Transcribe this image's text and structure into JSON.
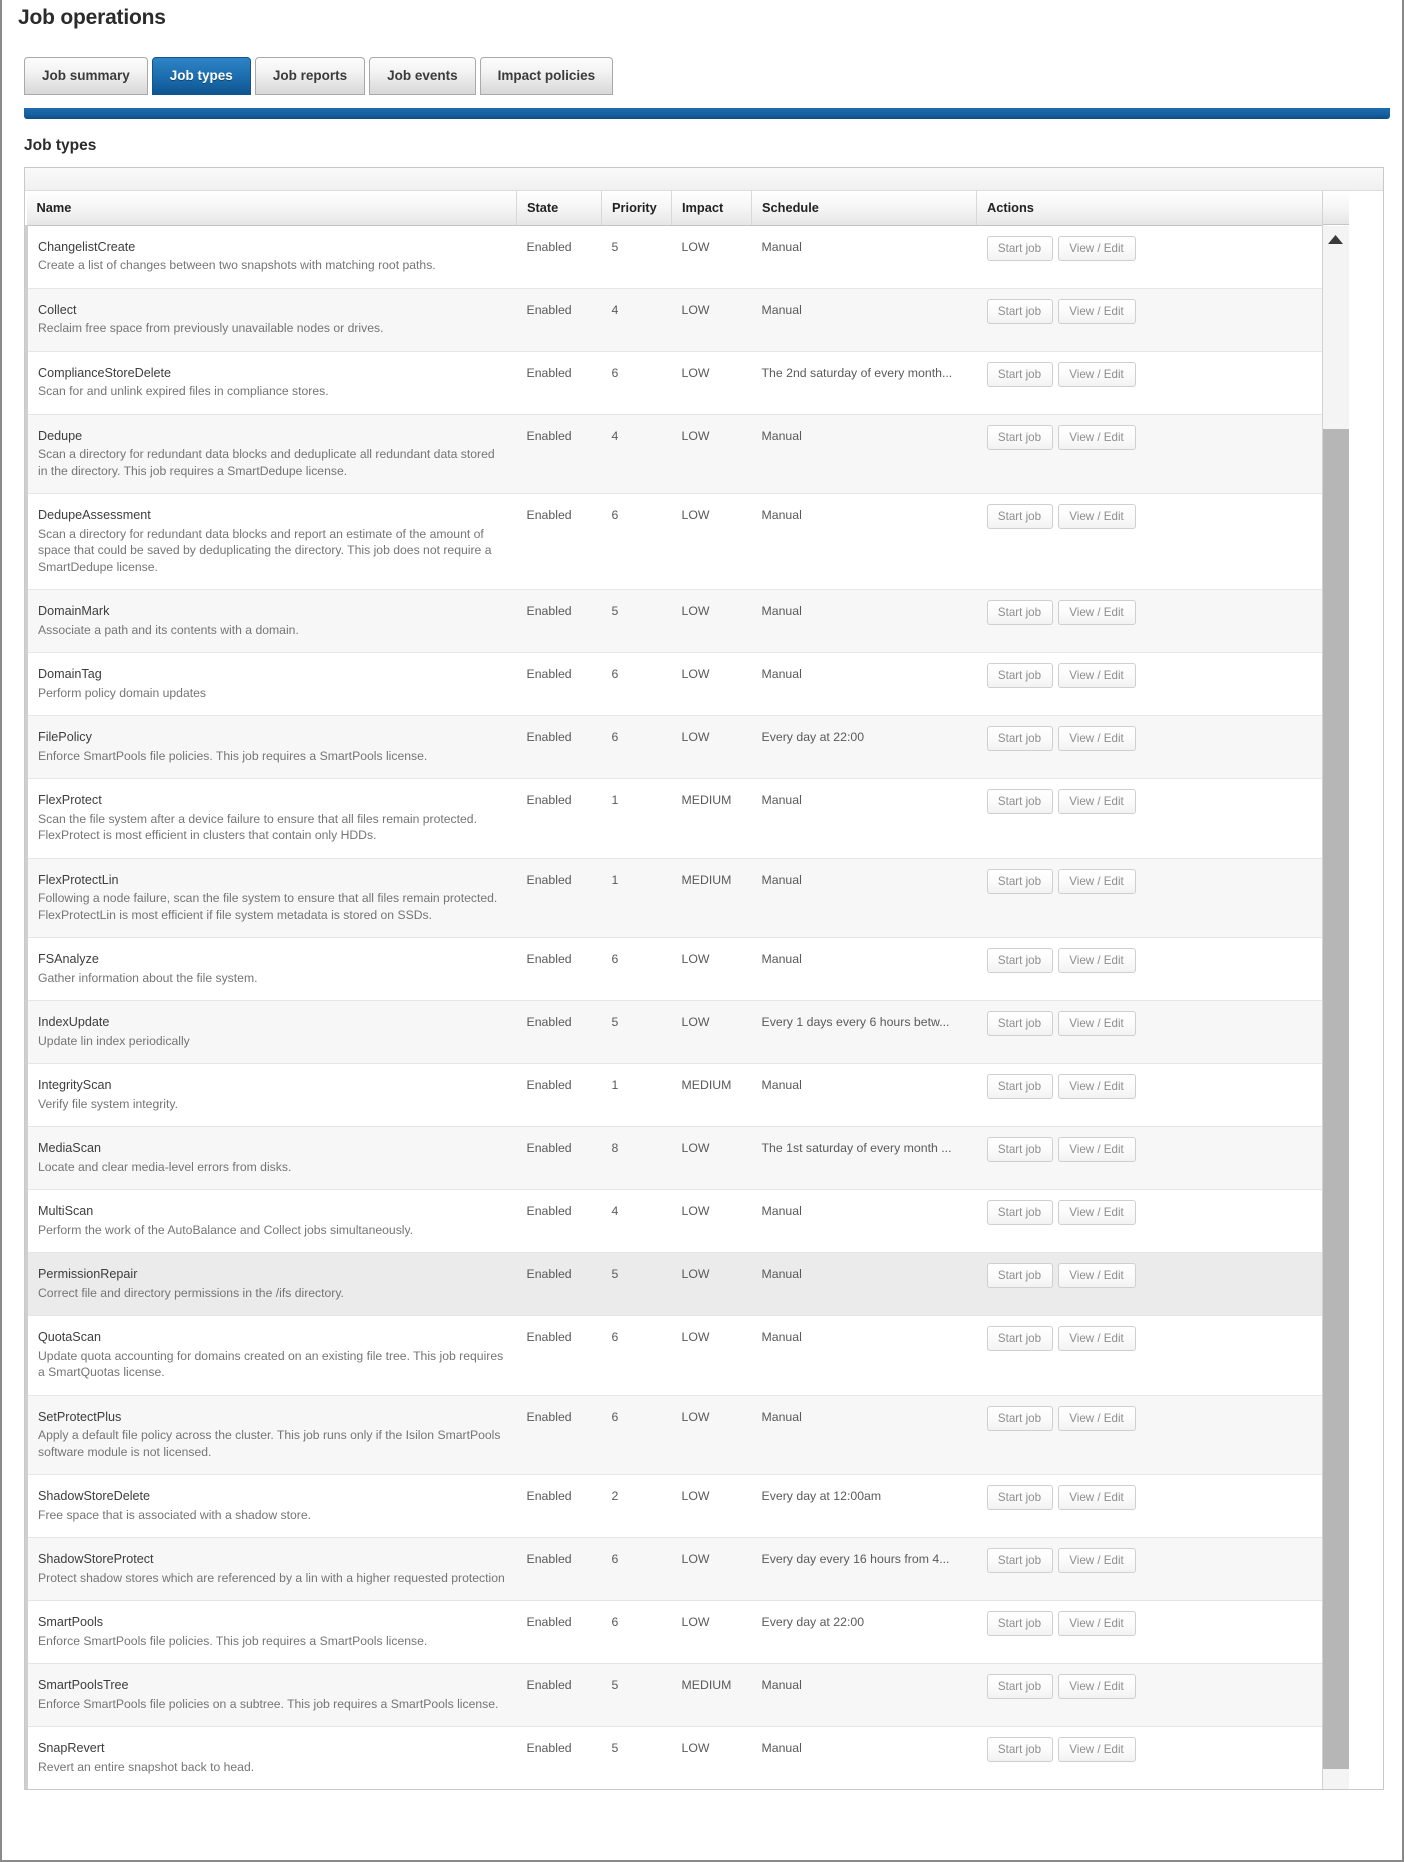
{
  "page": {
    "title": "Job operations",
    "section_title": "Job types"
  },
  "tabs": [
    {
      "label": "Job summary",
      "active": false
    },
    {
      "label": "Job types",
      "active": true
    },
    {
      "label": "Job reports",
      "active": false
    },
    {
      "label": "Job events",
      "active": false
    },
    {
      "label": "Impact policies",
      "active": false
    }
  ],
  "table": {
    "columns": [
      "Name",
      "State",
      "Priority",
      "Impact",
      "Schedule",
      "Actions"
    ],
    "action_labels": {
      "start": "Start job",
      "edit": "View / Edit"
    },
    "rows": [
      {
        "name": "ChangelistCreate",
        "description": "Create a list of changes between two snapshots with matching root paths.",
        "state": "Enabled",
        "priority": "5",
        "impact": "LOW",
        "schedule": "Manual"
      },
      {
        "name": "Collect",
        "description": "Reclaim free space from previously unavailable nodes or drives.",
        "state": "Enabled",
        "priority": "4",
        "impact": "LOW",
        "schedule": "Manual"
      },
      {
        "name": "ComplianceStoreDelete",
        "description": "Scan for and unlink expired files in compliance stores.",
        "state": "Enabled",
        "priority": "6",
        "impact": "LOW",
        "schedule": "The 2nd saturday of every month..."
      },
      {
        "name": "Dedupe",
        "description": "Scan a directory for redundant data blocks and deduplicate all redundant data stored in the directory. This job requires a SmartDedupe license.",
        "state": "Enabled",
        "priority": "4",
        "impact": "LOW",
        "schedule": "Manual"
      },
      {
        "name": "DedupeAssessment",
        "description": "Scan a directory for redundant data blocks and report an estimate of the amount of space that could be saved by deduplicating the directory. This job does not require a SmartDedupe license.",
        "state": "Enabled",
        "priority": "6",
        "impact": "LOW",
        "schedule": "Manual"
      },
      {
        "name": "DomainMark",
        "description": "Associate a path and its contents with a domain.",
        "state": "Enabled",
        "priority": "5",
        "impact": "LOW",
        "schedule": "Manual"
      },
      {
        "name": "DomainTag",
        "description": "Perform policy domain updates",
        "state": "Enabled",
        "priority": "6",
        "impact": "LOW",
        "schedule": "Manual"
      },
      {
        "name": "FilePolicy",
        "description": "Enforce SmartPools file policies. This job requires a SmartPools license.",
        "state": "Enabled",
        "priority": "6",
        "impact": "LOW",
        "schedule": "Every day at 22:00"
      },
      {
        "name": "FlexProtect",
        "description": "Scan the file system after a device failure to ensure that all files remain protected. FlexProtect is most efficient in clusters that contain only HDDs.",
        "state": "Enabled",
        "priority": "1",
        "impact": "MEDIUM",
        "schedule": "Manual"
      },
      {
        "name": "FlexProtectLin",
        "description": "Following a node failure, scan the file system to ensure that all files remain protected. FlexProtectLin is most efficient if file system metadata is stored on SSDs.",
        "state": "Enabled",
        "priority": "1",
        "impact": "MEDIUM",
        "schedule": "Manual"
      },
      {
        "name": "FSAnalyze",
        "description": "Gather information about the file system.",
        "state": "Enabled",
        "priority": "6",
        "impact": "LOW",
        "schedule": "Manual"
      },
      {
        "name": "IndexUpdate",
        "description": "Update lin index periodically",
        "state": "Enabled",
        "priority": "5",
        "impact": "LOW",
        "schedule": "Every 1 days every 6 hours betw..."
      },
      {
        "name": "IntegrityScan",
        "description": "Verify file system integrity.",
        "state": "Enabled",
        "priority": "1",
        "impact": "MEDIUM",
        "schedule": "Manual"
      },
      {
        "name": "MediaScan",
        "description": "Locate and clear media-level errors from disks.",
        "state": "Enabled",
        "priority": "8",
        "impact": "LOW",
        "schedule": "The 1st saturday of every month ..."
      },
      {
        "name": "MultiScan",
        "description": "Perform the work of the AutoBalance and Collect jobs simultaneously.",
        "state": "Enabled",
        "priority": "4",
        "impact": "LOW",
        "schedule": "Manual"
      },
      {
        "name": "PermissionRepair",
        "description": "Correct file and directory permissions in the /ifs directory.",
        "state": "Enabled",
        "priority": "5",
        "impact": "LOW",
        "schedule": "Manual"
      },
      {
        "name": "QuotaScan",
        "description": "Update quota accounting for domains created on an existing file tree. This job requires a SmartQuotas license.",
        "state": "Enabled",
        "priority": "6",
        "impact": "LOW",
        "schedule": "Manual"
      },
      {
        "name": "SetProtectPlus",
        "description": "Apply a default file policy across the cluster. This job runs only if the Isilon SmartPools software module is not licensed.",
        "state": "Enabled",
        "priority": "6",
        "impact": "LOW",
        "schedule": "Manual"
      },
      {
        "name": "ShadowStoreDelete",
        "description": "Free space that is associated with a shadow store.",
        "state": "Enabled",
        "priority": "2",
        "impact": "LOW",
        "schedule": "Every day at 12:00am"
      },
      {
        "name": "ShadowStoreProtect",
        "description": "Protect shadow stores which are referenced by a lin with a higher requested protection",
        "state": "Enabled",
        "priority": "6",
        "impact": "LOW",
        "schedule": "Every day every 16 hours from 4..."
      },
      {
        "name": "SmartPools",
        "description": "Enforce SmartPools file policies. This job requires a SmartPools license.",
        "state": "Enabled",
        "priority": "6",
        "impact": "LOW",
        "schedule": "Every day at 22:00"
      },
      {
        "name": "SmartPoolsTree",
        "description": "Enforce SmartPools file policies on a subtree. This job requires a SmartPools license.",
        "state": "Enabled",
        "priority": "5",
        "impact": "MEDIUM",
        "schedule": "Manual"
      },
      {
        "name": "SnapRevert",
        "description": "Revert an entire snapshot back to head.",
        "state": "Enabled",
        "priority": "5",
        "impact": "LOW",
        "schedule": "Manual"
      }
    ]
  },
  "scrollbar": {
    "up_arrow_icon": "triangle-up-icon"
  },
  "colors": {
    "accent": "#1b6cad",
    "rule": "#155f9e",
    "text": "#4a4a4a"
  }
}
